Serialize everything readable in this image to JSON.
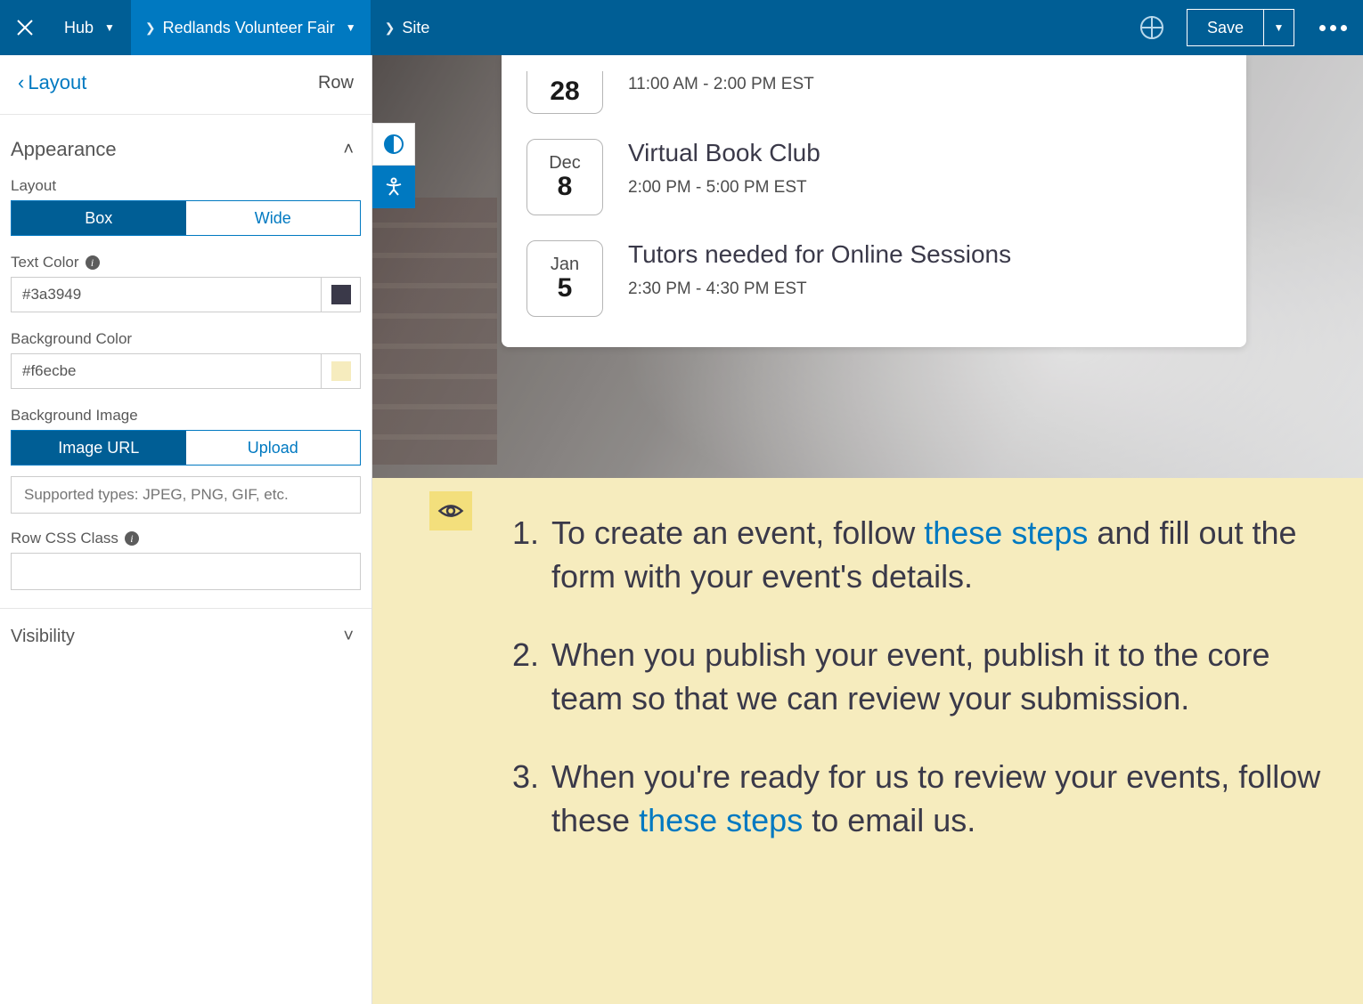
{
  "topbar": {
    "hub_label": "Hub",
    "breadcrumb_active": "Redlands Volunteer Fair",
    "breadcrumb_site": "Site",
    "save_label": "Save"
  },
  "panel": {
    "back_label": "Layout",
    "context_label": "Row",
    "sections": {
      "appearance": "Appearance",
      "visibility": "Visibility"
    },
    "labels": {
      "layout": "Layout",
      "text_color": "Text Color",
      "bg_color": "Background Color",
      "bg_image": "Background Image",
      "row_css": "Row CSS Class"
    },
    "layout_toggle": {
      "box": "Box",
      "wide": "Wide",
      "selected": "box"
    },
    "text_color_value": "#3a3949",
    "bg_color_value": "#f6ecbe",
    "bg_image_toggle": {
      "url": "Image URL",
      "upload": "Upload",
      "selected": "url"
    },
    "bg_image_placeholder": "Supported types: JPEG, PNG, GIF, etc.",
    "row_css_value": ""
  },
  "colors": {
    "text_swatch": "#3a3949",
    "bg_swatch": "#f6ecbe",
    "accent": "#0079c1"
  },
  "events": [
    {
      "month": "",
      "day": "28",
      "title": "",
      "time": "11:00 AM - 2:00 PM EST"
    },
    {
      "month": "Dec",
      "day": "8",
      "title": "Virtual Book Club",
      "time": "2:00 PM - 5:00 PM EST"
    },
    {
      "month": "Jan",
      "day": "5",
      "title": "Tutors needed for Online Sessions",
      "time": "2:30 PM - 4:30 PM EST"
    }
  ],
  "instructions": {
    "item1_pre": "To create an event, follow ",
    "item1_link": "these steps",
    "item1_post": " and fill out the form with your event's details.",
    "item2": "When you publish your event, publish it to the core team so that we can review your submission.",
    "item3_pre": "When you're ready for us to review your events, follow these ",
    "item3_link": "these steps",
    "item3_post": " to email us."
  }
}
